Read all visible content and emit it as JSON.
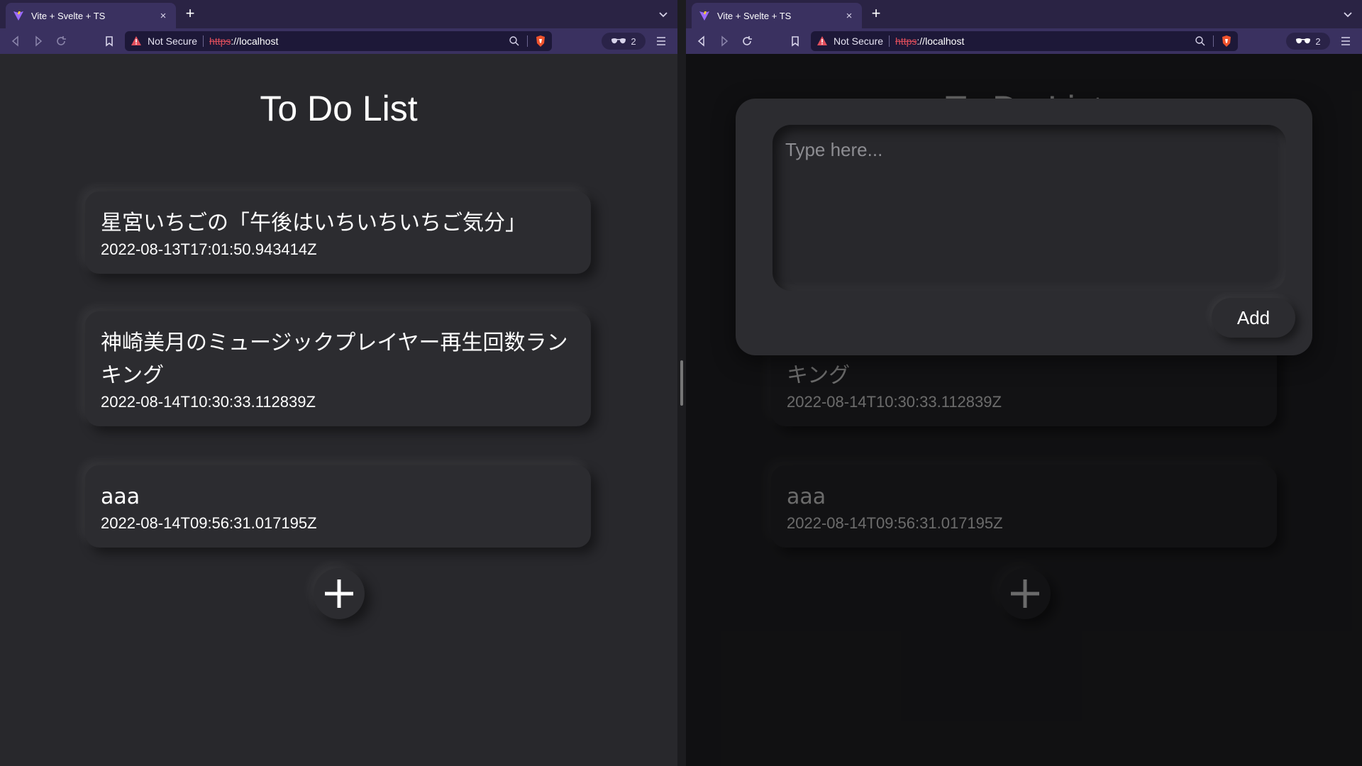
{
  "browser": {
    "tab_title": "Vite + Svelte + TS",
    "not_secure": "Not Secure",
    "url_scheme": "https",
    "url_sep": "://",
    "url_host": "localhost",
    "private_count": "2"
  },
  "page": {
    "title": "To Do List",
    "todos": [
      {
        "title": "星宮いちごの「午後はいちいちいちご気分」",
        "timestamp": "2022-08-13T17:01:50.943414Z"
      },
      {
        "title": "神崎美月のミュージックプレイヤー再生回数ランキング",
        "timestamp": "2022-08-14T10:30:33.112839Z"
      },
      {
        "title": "aaa",
        "timestamp": "2022-08-14T09:56:31.017195Z"
      }
    ]
  },
  "modal": {
    "placeholder": "Type here...",
    "add_label": "Add"
  },
  "colors": {
    "tab_strip": "#2a2344",
    "toolbar": "#3a3160",
    "page_bg": "#28282c",
    "card_bg": "#2c2c30",
    "url_https_strike": "#e04e5c",
    "warning": "#e04e5c"
  },
  "icons": {
    "tab": "vite-logo-icon",
    "close": "close-icon",
    "new_tab": "plus-icon",
    "back": "back-icon",
    "forward": "forward-icon",
    "reload": "reload-icon",
    "bookmark": "bookmark-icon",
    "warning": "warning-icon",
    "zoom": "zoom-icon",
    "shield": "brave-shield-icon",
    "private": "private-glasses-icon",
    "menu": "hamburger-menu-icon",
    "fab": "plus-icon"
  }
}
